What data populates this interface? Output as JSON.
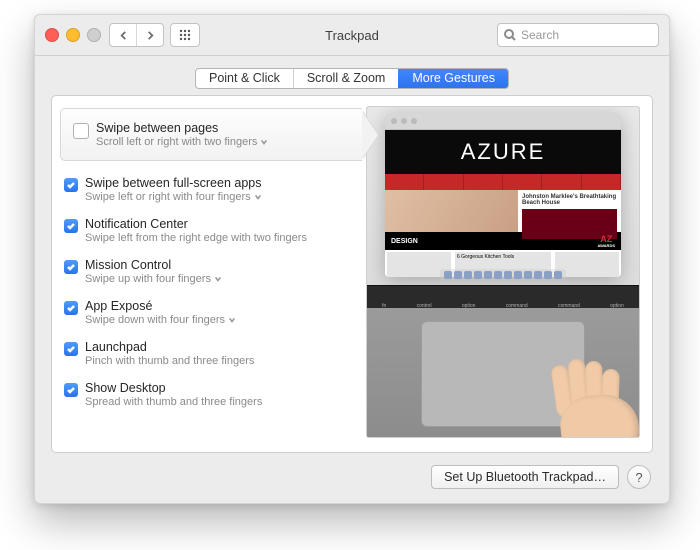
{
  "window": {
    "title": "Trackpad"
  },
  "toolbar": {
    "search_placeholder": "Search"
  },
  "tabs": {
    "items": [
      {
        "label": "Point & Click",
        "active": false
      },
      {
        "label": "Scroll & Zoom",
        "active": false
      },
      {
        "label": "More Gestures",
        "active": true
      }
    ]
  },
  "options": [
    {
      "checked": false,
      "selected": true,
      "has_dropdown": true,
      "title": "Swipe between pages",
      "subtitle": "Scroll left or right with two fingers"
    },
    {
      "checked": true,
      "selected": false,
      "has_dropdown": true,
      "title": "Swipe between full-screen apps",
      "subtitle": "Swipe left or right with four fingers"
    },
    {
      "checked": true,
      "selected": false,
      "has_dropdown": false,
      "title": "Notification Center",
      "subtitle": "Swipe left from the right edge with two fingers"
    },
    {
      "checked": true,
      "selected": false,
      "has_dropdown": true,
      "title": "Mission Control",
      "subtitle": "Swipe up with four fingers"
    },
    {
      "checked": true,
      "selected": false,
      "has_dropdown": true,
      "title": "App Exposé",
      "subtitle": "Swipe down with four fingers"
    },
    {
      "checked": true,
      "selected": false,
      "has_dropdown": false,
      "title": "Launchpad",
      "subtitle": "Pinch with thumb and three fingers"
    },
    {
      "checked": true,
      "selected": false,
      "has_dropdown": false,
      "title": "Show Desktop",
      "subtitle": "Spread with thumb and three fingers"
    }
  ],
  "preview": {
    "brand": "AZURE",
    "side_headline": "Johnston Marklee's Breathtaking Beach House",
    "section_label": "DESIGN",
    "side_small": "6 Gorgeous Kitchen Tools",
    "az_logo": "AZ",
    "az_sub": "AWARDS",
    "key_labels": [
      "fn",
      "control",
      "option",
      "command",
      "command",
      "option"
    ]
  },
  "footer": {
    "bluetooth_label": "Set Up Bluetooth Trackpad…",
    "help_label": "?"
  }
}
